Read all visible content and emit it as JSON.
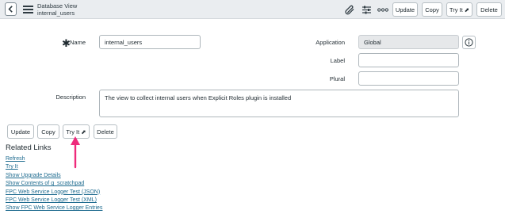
{
  "header": {
    "record_type": "Database View",
    "record_name": "internal_users",
    "buttons": {
      "update": "Update",
      "copy": "Copy",
      "try_it": "Try It ⬈",
      "delete": "Delete"
    },
    "icons": [
      "back-icon",
      "menu-icon",
      "paperclip-icon",
      "settings-sliders-icon",
      "more-options-icon"
    ]
  },
  "form": {
    "name_label": "Name",
    "name_value": "internal_users",
    "application_label": "Application",
    "application_value": "Global",
    "label_label": "Label",
    "label_value": "",
    "plural_label": "Plural",
    "plural_value": "",
    "description_label": "Description",
    "description_value": "The view to collect internal users when Explicit Roles plugin is installed"
  },
  "bottom_buttons": {
    "update": "Update",
    "copy": "Copy",
    "try_it": "Try It ⬈",
    "delete": "Delete"
  },
  "related_links": {
    "title": "Related Links",
    "items": [
      "Refresh",
      "Try It",
      "Show Upgrade Details",
      "Show Contents of g_scratchpad",
      "FPC Web Service Logger Test (JSON)",
      "FPC Web Service Logger Test (XML)",
      "Show FPC Web Service Logger Entries"
    ]
  },
  "colors": {
    "header_bg": "#eaedf0",
    "link": "#1e6b8f",
    "annotation_arrow": "#ee2a7b",
    "readonly_bg": "#e6e8ea"
  }
}
